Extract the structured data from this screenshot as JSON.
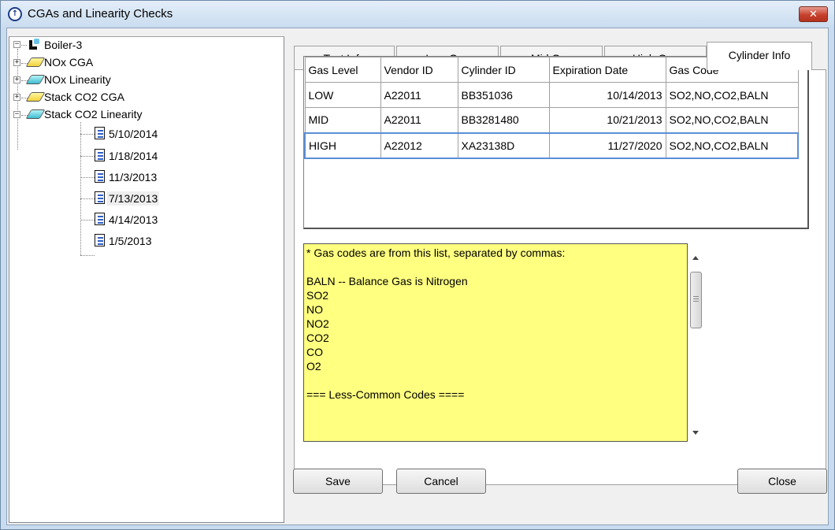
{
  "window": {
    "title": "CGAs and Linearity Checks",
    "close_glyph": "✕",
    "icon": "app-logo-icon"
  },
  "tree": {
    "root": "Boiler-3",
    "groups": [
      {
        "label": "NOx CGA",
        "icon": "yellow-book-icon",
        "expanded": false
      },
      {
        "label": "NOx Linearity",
        "icon": "cyan-book-icon",
        "expanded": false
      },
      {
        "label": "Stack CO2 CGA",
        "icon": "yellow-book-icon",
        "expanded": false
      },
      {
        "label": "Stack CO2 Linearity",
        "icon": "cyan-book-icon",
        "expanded": true
      }
    ],
    "dates": [
      "5/10/2014",
      "1/18/2014",
      "11/3/2013",
      "7/13/2013",
      "4/14/2013",
      "1/5/2013"
    ],
    "selected_date": "7/13/2013"
  },
  "tabs": [
    "Test Info",
    "Low Gas",
    "Mid Gas",
    "High Gas",
    "Cylinder Info"
  ],
  "active_tab": "Cylinder Info",
  "grid": {
    "columns": [
      "Gas Level",
      "Vendor ID",
      "Cylinder ID",
      "Expiration Date",
      "Gas Code"
    ],
    "rows": [
      [
        "LOW",
        "A22011",
        "BB351036",
        "10/14/2013",
        "SO2,NO,CO2,BALN"
      ],
      [
        "MID",
        "A22011",
        "BB3281480",
        "10/21/2013",
        "SO2,NO,CO2,BALN"
      ],
      [
        "HIGH",
        "A22012",
        "XA23138D",
        "11/27/2020",
        "SO2,NO,CO2,BALN"
      ]
    ],
    "selected_row": 2
  },
  "notes": {
    "lines": [
      "* Gas codes are from this list, separated by commas:",
      "",
      "BALN -- Balance Gas is Nitrogen",
      "SO2",
      "NO",
      "NO2",
      "CO2",
      "CO",
      "O2",
      "",
      "=== Less-Common Codes ===="
    ],
    "background": "#ffff80"
  },
  "buttons": {
    "save": "Save",
    "cancel": "Cancel",
    "close": "Close"
  }
}
